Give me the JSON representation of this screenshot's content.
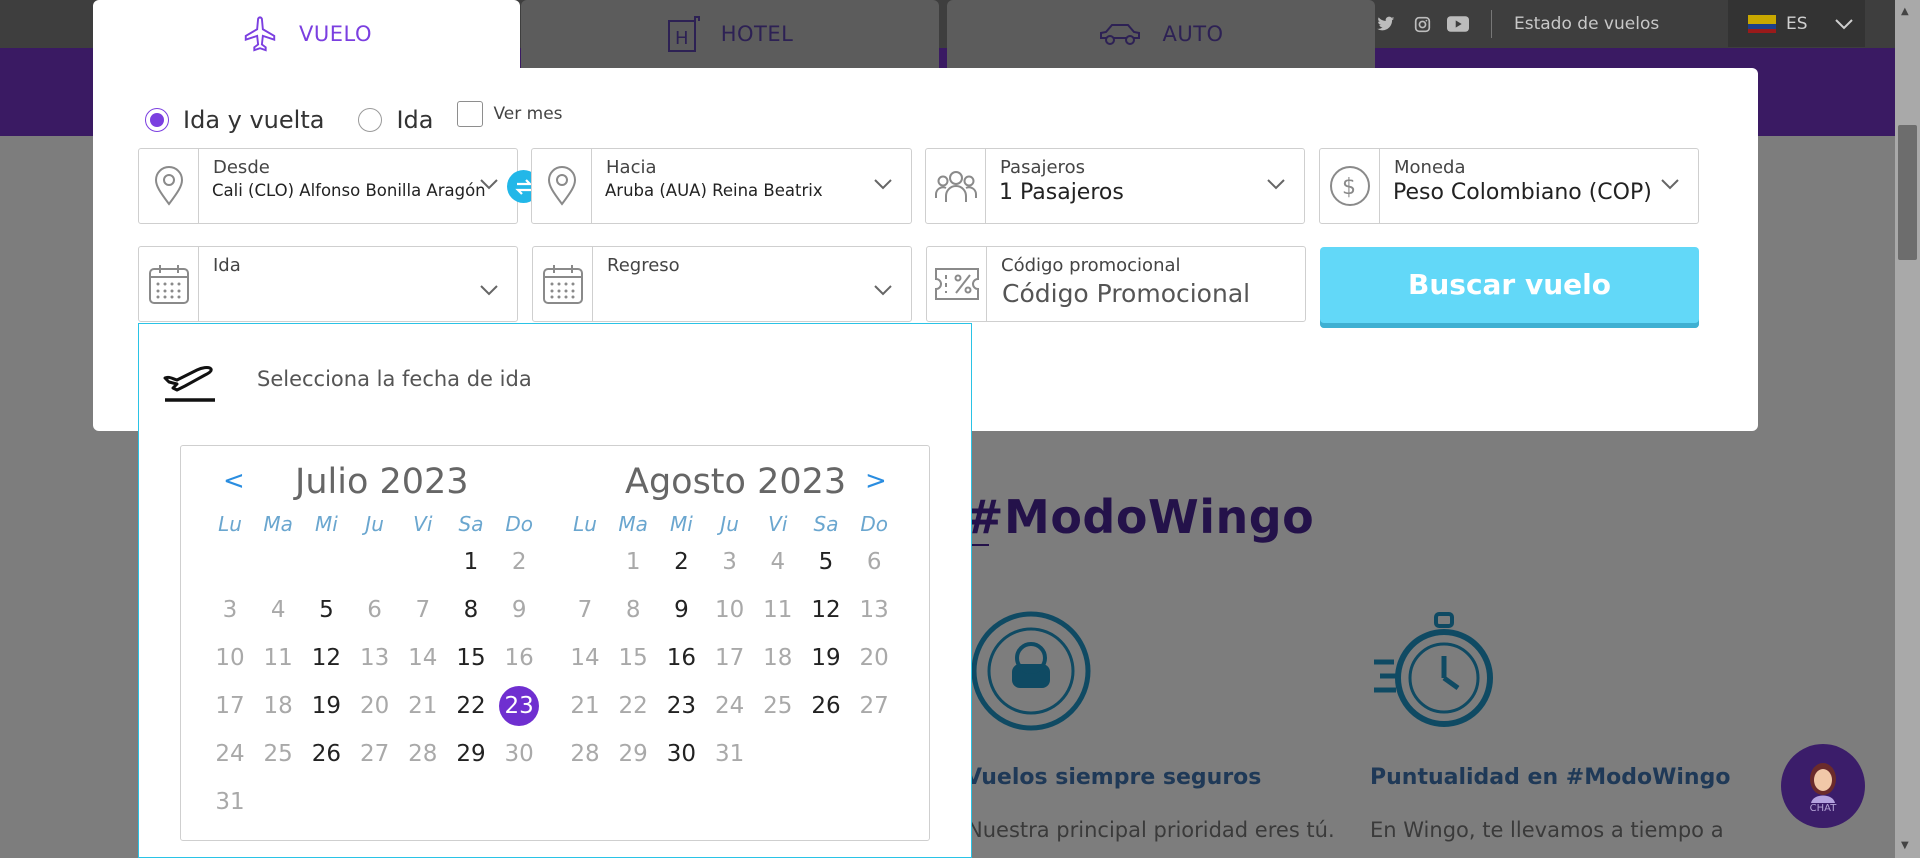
{
  "tabs": [
    {
      "label": "VUELO",
      "icon": "airplane-icon",
      "active": true
    },
    {
      "label": "HOTEL",
      "icon": "hotel-icon",
      "active": false
    },
    {
      "label": "AUTO",
      "icon": "car-icon",
      "active": false
    }
  ],
  "topbar": {
    "flight_status": "Estado de vuelos",
    "language": "ES"
  },
  "trip_type": {
    "round_trip": "Ida y vuelta",
    "one_way": "Ida",
    "selected": "round_trip",
    "see_month": "Ver mes"
  },
  "fields": {
    "from_label": "Desde",
    "from_value": "Cali (CLO) Alfonso Bonilla Aragón",
    "to_label": "Hacia",
    "to_value": "Aruba (AUA) Reina Beatrix",
    "pax_label": "Pasajeros",
    "pax_value": "1 Pasajeros",
    "currency_label": "Moneda",
    "currency_value": "Peso Colombiano (COP)",
    "depart_label": "Ida",
    "depart_value": "",
    "return_label": "Regreso",
    "return_value": "",
    "promo_label": "Código promocional",
    "promo_placeholder": "Código Promocional"
  },
  "search_button": "Buscar vuelo",
  "calendar": {
    "heading": "Selecciona la fecha de ida",
    "prev": "<",
    "next": ">",
    "weekdays": [
      "Lu",
      "Ma",
      "Mi",
      "Ju",
      "Vi",
      "Sa",
      "Do"
    ],
    "months": [
      {
        "title": "Julio 2023",
        "first_weekday": 5,
        "days": 31,
        "enabled": [
          1,
          5,
          8,
          12,
          15,
          19,
          22,
          23,
          26,
          29
        ],
        "selected": 23
      },
      {
        "title": "Agosto 2023",
        "first_weekday": 1,
        "days": 31,
        "enabled": [
          2,
          5,
          9,
          12,
          16,
          19,
          23,
          26,
          30
        ],
        "selected": null
      }
    ]
  },
  "background": {
    "headline": "#ModoWingo",
    "feature1_title": "Vuelos siempre seguros",
    "feature1_text": "Nuestra principal prioridad eres tú.",
    "feature2_title": "Puntualidad en #ModoWingo",
    "feature2_text": "En Wingo, te llevamos a tiempo a"
  },
  "chat_label": "CHAT",
  "colors": {
    "accent": "#7b3fe0",
    "selected_day": "#6f2fd0",
    "search_button": "#62d8f8",
    "swap": "#22b7e8"
  }
}
